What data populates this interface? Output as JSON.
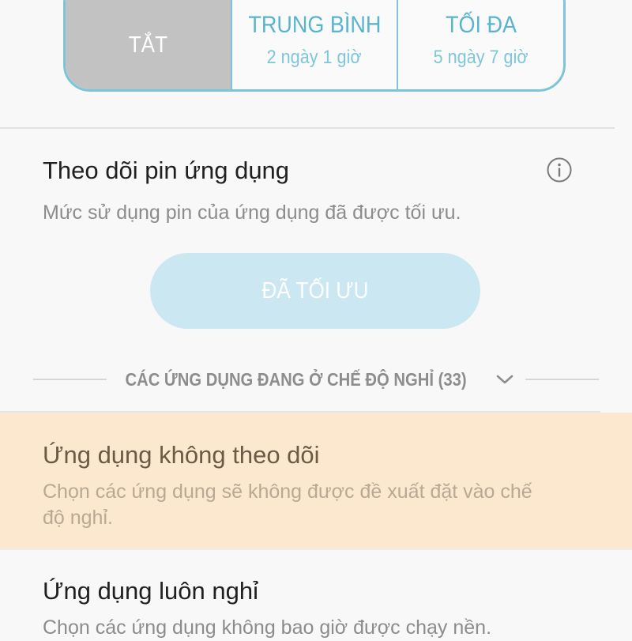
{
  "power_mode": {
    "options": [
      {
        "title": "TẮT",
        "subtitle": ""
      },
      {
        "title": "TRUNG BÌNH",
        "subtitle": "2 ngày 1 giờ"
      },
      {
        "title": "TỐI ĐA",
        "subtitle": "5 ngày 7 giờ"
      }
    ],
    "selected": "TẮT"
  },
  "app_power_monitor": {
    "title": "Theo dõi pin ứng dụng",
    "description": "Mức sử dụng pin của ứng dụng đã được tối ưu.",
    "button_label": "ĐÃ TỐI ƯU",
    "info_icon": "info-icon"
  },
  "sleeping_apps": {
    "label": "CÁC ỨNG DỤNG ĐANG Ở CHẾ ĐỘ NGHỈ (33)",
    "chevron_icon": "chevron-down-icon"
  },
  "list": [
    {
      "title": "Ứng dụng không theo dõi",
      "description": "Chọn các ứng dụng sẽ không được đề xuất đặt vào chế độ nghỉ."
    },
    {
      "title": "Ứng dụng luôn nghỉ",
      "description": "Chọn các ứng dụng không bao giờ được chạy nền."
    }
  ],
  "colors": {
    "accent": "#58b4cf",
    "selected_segment": "#c2c2c2",
    "button_disabled": "#cbe7f1",
    "highlight_row": "#fbe8ce"
  }
}
